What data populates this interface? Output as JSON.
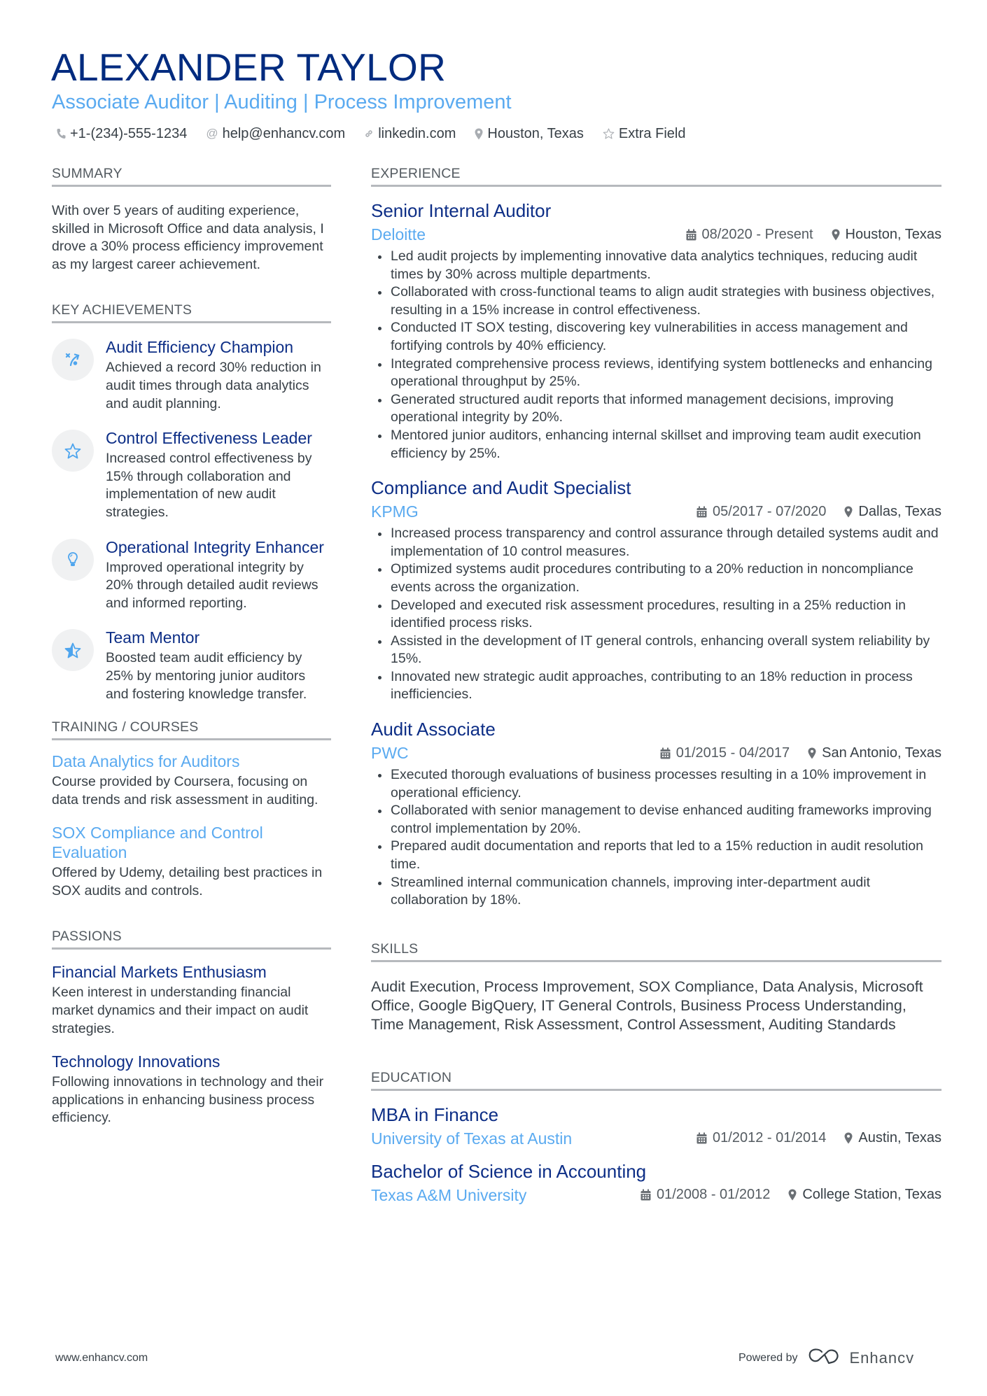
{
  "header": {
    "name": "ALEXANDER TAYLOR",
    "subtitle": "Associate Auditor | Auditing | Process Improvement",
    "contacts": [
      {
        "icon": "phone-icon",
        "text": "+1-(234)-555-1234"
      },
      {
        "icon": "at-icon",
        "text": "help@enhancv.com"
      },
      {
        "icon": "link-icon",
        "text": "linkedin.com"
      },
      {
        "icon": "location-pin-icon",
        "text": "Houston, Texas"
      },
      {
        "icon": "star-outline-icon",
        "text": "Extra Field"
      }
    ]
  },
  "colors": {
    "name": "#002b7f",
    "accent_light": "#5aaaf0",
    "heading_dark": "#0d2e86",
    "text": "#384047",
    "rule": "#b6b9bd"
  },
  "summary": {
    "title": "SUMMARY",
    "text": "With over 5 years of auditing experience, skilled in Microsoft Office and data analysis, I drove a 30% process efficiency improvement as my largest career achievement."
  },
  "achievements": {
    "title": "KEY ACHIEVEMENTS",
    "items": [
      {
        "icon": "strategy-arrow-icon",
        "title": "Audit Efficiency Champion",
        "text": "Achieved a record 30% reduction in audit times through data analytics and audit planning."
      },
      {
        "icon": "star-outline-icon",
        "title": "Control Effectiveness Leader",
        "text": "Increased control effectiveness by 15% through collaboration and implementation of new audit strategies."
      },
      {
        "icon": "lightbulb-icon",
        "title": "Operational Integrity Enhancer",
        "text": "Improved operational integrity by 20% through detailed audit reviews and informed reporting."
      },
      {
        "icon": "star-half-icon",
        "title": "Team Mentor",
        "text": "Boosted team audit efficiency by 25% by mentoring junior auditors and fostering knowledge transfer."
      }
    ]
  },
  "training": {
    "title": "TRAINING / COURSES",
    "items": [
      {
        "title": "Data Analytics for Auditors",
        "text": "Course provided by Coursera, focusing on data trends and risk assessment in auditing."
      },
      {
        "title": "SOX Compliance and Control Evaluation",
        "text": "Offered by Udemy, detailing best practices in SOX audits and controls."
      }
    ]
  },
  "passions": {
    "title": "PASSIONS",
    "items": [
      {
        "title": "Financial Markets Enthusiasm",
        "text": "Keen interest in understanding financial market dynamics and their impact on audit strategies."
      },
      {
        "title": "Technology Innovations",
        "text": "Following innovations in technology and their applications in enhancing business process efficiency."
      }
    ]
  },
  "experience": {
    "title": "EXPERIENCE",
    "jobs": [
      {
        "title": "Senior Internal Auditor",
        "company": "Deloitte",
        "dates": "08/2020 - Present",
        "location": "Houston, Texas",
        "bullets": [
          "Led audit projects by implementing innovative data analytics techniques, reducing audit times by 30% across multiple departments.",
          "Collaborated with cross-functional teams to align audit strategies with business objectives, resulting in a 15% increase in control effectiveness.",
          "Conducted IT SOX testing, discovering key vulnerabilities in access management and fortifying controls by 40% efficiency.",
          "Integrated comprehensive process reviews, identifying system bottlenecks and enhancing operational throughput by 25%.",
          "Generated structured audit reports that informed management decisions, improving operational integrity by 20%.",
          "Mentored junior auditors, enhancing internal skillset and improving team audit execution efficiency by 25%."
        ]
      },
      {
        "title": "Compliance and Audit Specialist",
        "company": "KPMG",
        "dates": "05/2017 - 07/2020",
        "location": "Dallas, Texas",
        "bullets": [
          "Increased process transparency and control assurance through detailed systems audit and implementation of 10 control measures.",
          "Optimized systems audit procedures contributing to a 20% reduction in noncompliance events across the organization.",
          "Developed and executed risk assessment procedures, resulting in a 25% reduction in identified process risks.",
          "Assisted in the development of IT general controls, enhancing overall system reliability by 15%.",
          "Innovated new strategic audit approaches, contributing to an 18% reduction in process inefficiencies."
        ]
      },
      {
        "title": "Audit Associate",
        "company": "PWC",
        "dates": "01/2015 - 04/2017",
        "location": "San Antonio, Texas",
        "bullets": [
          "Executed thorough evaluations of business processes resulting in a 10% improvement in operational efficiency.",
          "Collaborated with senior management to devise enhanced auditing frameworks improving control implementation by 20%.",
          "Prepared audit documentation and reports that led to a 15% reduction in audit resolution time.",
          "Streamlined internal communication channels, improving inter-department audit collaboration by 18%."
        ]
      }
    ]
  },
  "skills": {
    "title": "SKILLS",
    "text": "Audit Execution, Process Improvement, SOX Compliance, Data Analysis, Microsoft Office, Google BigQuery, IT General Controls, Business Process Understanding, Time Management, Risk Assessment, Control Assessment, Auditing Standards"
  },
  "education": {
    "title": "EDUCATION",
    "items": [
      {
        "degree": "MBA in Finance",
        "school": "University of Texas at Austin",
        "dates": "01/2012 - 01/2014",
        "location": "Austin, Texas"
      },
      {
        "degree": "Bachelor of Science in Accounting",
        "school": "Texas A&M University",
        "dates": "01/2008 - 01/2012",
        "location": "College Station, Texas"
      }
    ]
  },
  "footer": {
    "website": "www.enhancv.com",
    "powered_by": "Powered by",
    "brand": "Enhancv"
  }
}
